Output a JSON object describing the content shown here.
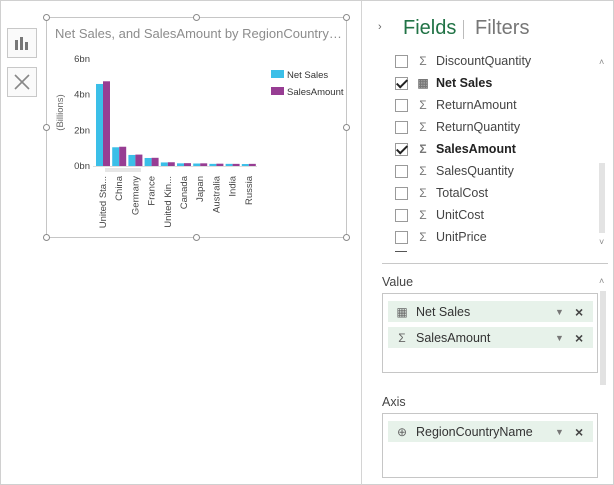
{
  "chart": {
    "title": "Net Sales, and SalesAmount by RegionCountryName",
    "chart_data": {
      "type": "bar",
      "title": "Net Sales, and SalesAmount by RegionCountryName",
      "ylabel": "(Billions)",
      "xlabel": "",
      "yticks": [
        "6bn",
        "4bn",
        "2bn",
        "0bn"
      ],
      "ytick_values": [
        6,
        4,
        2,
        0
      ],
      "ylim": [
        0,
        6
      ],
      "legend_position": "right",
      "categories": [
        "United Sta...",
        "China",
        "Germany",
        "France",
        "United Kin...",
        "Canada",
        "Japan",
        "Australia",
        "India",
        "Russia"
      ],
      "series": [
        {
          "name": "Net Sales",
          "color": "#3bbfe8",
          "values": [
            4.6,
            1.05,
            0.62,
            0.45,
            0.2,
            0.15,
            0.14,
            0.12,
            0.12,
            0.11
          ]
        },
        {
          "name": "SalesAmount",
          "color": "#973d93",
          "values": [
            4.75,
            1.08,
            0.64,
            0.46,
            0.21,
            0.16,
            0.15,
            0.13,
            0.12,
            0.12
          ]
        }
      ]
    }
  },
  "tools": {
    "chart_icon": "bar-chart-icon",
    "clear_icon": "clear-icon"
  },
  "panel": {
    "collapse_glyph": "›",
    "tab_fields": "Fields",
    "tab_filters": "Filters",
    "fields": [
      {
        "label": "DiscountQuantity",
        "checked": false,
        "icon": "Σ"
      },
      {
        "label": "Net Sales",
        "checked": true,
        "icon": "▦"
      },
      {
        "label": "ReturnAmount",
        "checked": false,
        "icon": "Σ"
      },
      {
        "label": "ReturnQuantity",
        "checked": false,
        "icon": "Σ"
      },
      {
        "label": "SalesAmount",
        "checked": true,
        "icon": "Σ"
      },
      {
        "label": "SalesQuantity",
        "checked": false,
        "icon": "Σ"
      },
      {
        "label": "TotalCost",
        "checked": false,
        "icon": "Σ"
      },
      {
        "label": "UnitCost",
        "checked": false,
        "icon": "Σ"
      },
      {
        "label": "UnitPrice",
        "checked": false,
        "icon": "Σ"
      }
    ],
    "value_label": "Value",
    "value_items": [
      {
        "label": "Net Sales",
        "icon": "▦"
      },
      {
        "label": "SalesAmount",
        "icon": "Σ"
      }
    ],
    "axis_label": "Axis",
    "axis_items": [
      {
        "label": "RegionCountryName",
        "icon": "⊕"
      }
    ],
    "dropdown_glyph": "▼",
    "remove_glyph": "×",
    "scroll_up_glyph": "˄",
    "scroll_down_glyph": "˅"
  }
}
